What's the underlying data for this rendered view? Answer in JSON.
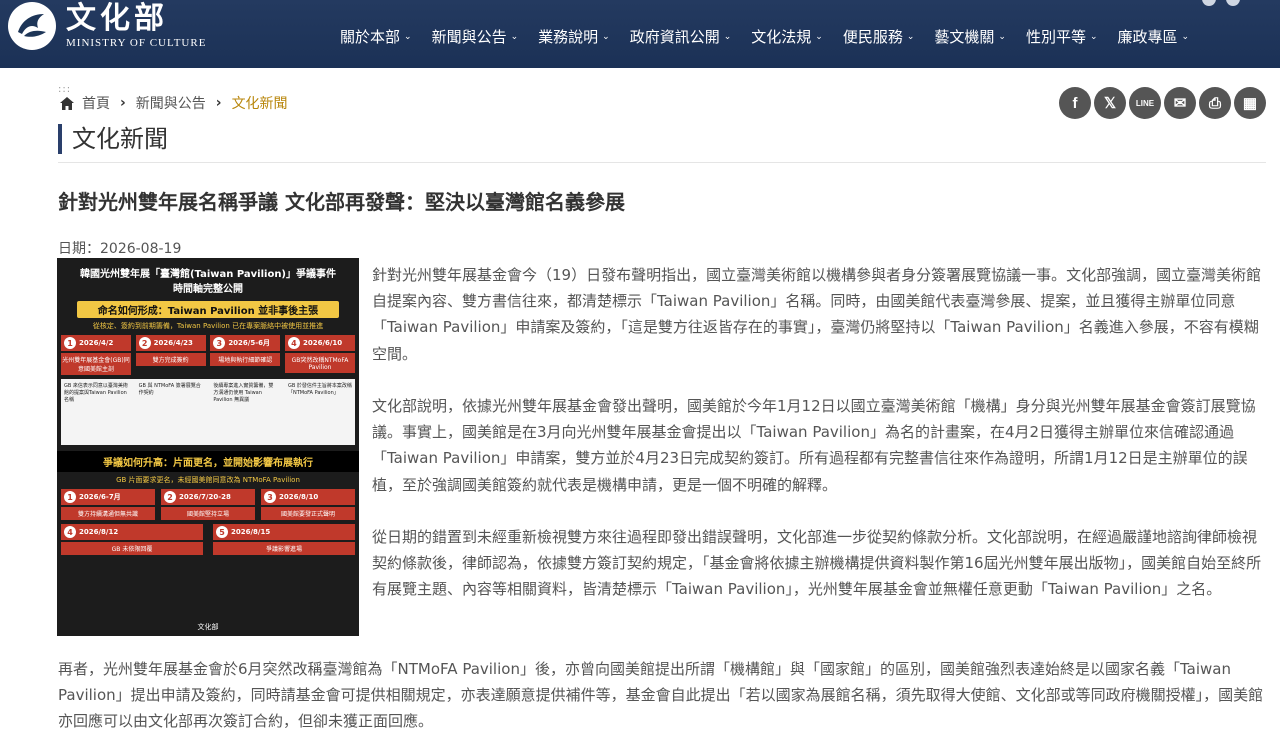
{
  "header": {
    "logo_zh": "文化部",
    "logo_en": "MINISTRY OF CULTURE",
    "nav": [
      {
        "label": "關於本部"
      },
      {
        "label": "新聞與公告"
      },
      {
        "label": "業務說明"
      },
      {
        "label": "政府資訊公開"
      },
      {
        "label": "文化法規"
      },
      {
        "label": "便民服務"
      },
      {
        "label": "藝文機關"
      },
      {
        "label": "性別平等"
      },
      {
        "label": "廉政專區"
      }
    ],
    "colors": {
      "nav_bg": "#1d3557",
      "accent": "#b8860b"
    }
  },
  "breadcrumb": {
    "dots": ":::",
    "home": "首頁",
    "section": "新聞與公告",
    "current": "文化新聞"
  },
  "share": {
    "buttons": [
      {
        "icon": "facebook-icon",
        "glyph": "f"
      },
      {
        "icon": "x-icon",
        "glyph": "𝕏"
      },
      {
        "icon": "line-icon",
        "glyph": "LINE"
      },
      {
        "icon": "email-icon",
        "glyph": "✉"
      },
      {
        "icon": "print-icon",
        "glyph": "⎙"
      },
      {
        "icon": "qrcode-icon",
        "glyph": "▦"
      }
    ]
  },
  "page_title": "文化新聞",
  "article": {
    "headline": "針對光州雙年展名稱爭議 文化部再發聲：堅決以臺灣館名義參展",
    "date": "日期：2026-08-19",
    "paragraphs": [
      "針對光州雙年展基金會今（19）日發布聲明指出，國立臺灣美術館以機構參與者身分簽署展覽協議一事。文化部強調，國立臺灣美術館自提案內容、雙方書信往來，都清楚標示「Taiwan Pavilion」名稱。同時，由國美館代表臺灣參展、提案，並且獲得主辦單位同意「Taiwan Pavilion」申請案及簽約，「這是雙方往返皆存在的事實」，臺灣仍將堅持以「Taiwan Pavilion」名義進入參展，不容有模糊空間。",
      "文化部說明，依據光州雙年展基金會發出聲明，國美館於今年1月12日以國立臺灣美術館「機構」身分與光州雙年展基金會簽訂展覽協議。事實上，國美館是在3月向光州雙年展基金會提出以「Taiwan Pavilion」為名的計畫案，在4月2日獲得主辦單位來信確認通過「Taiwan Pavilion」申請案，雙方並於4月23日完成契約簽訂。所有過程都有完整書信往來作為證明，所謂1月12日是主辦單位的誤植，至於強調國美館簽約就代表是機構申請，更是一個不明確的解釋。",
      "從日期的錯置到未經重新檢視雙方來往過程即發出錯誤聲明，文化部進一步從契約條款分析。文化部說明，在經過嚴謹地諮詢律師檢視契約條款後，律師認為，依據雙方簽訂契約規定，「基金會將依據主辦機構提供資料製作第16屆光州雙年展出版物」，國美館自始至終所有展覽主題、內容等相關資料，皆清楚標示「Taiwan Pavilion」，光州雙年展基金會並無權任意更動「Taiwan Pavilion」之名。",
      "再者，光州雙年展基金會於6月突然改稱臺灣館為「NTMoFA Pavilion」後，亦曾向國美館提出所謂「機構館」與「國家館」的區別，國美館強烈表達始終是以國家名義「Taiwan Pavilion」提出申請及簽約，同時請基金會可提供相關規定，亦表達願意提供補件等，基金會自此提出「若以國家為展館名稱，須先取得大使館、文化部或等同政府機關授權」，國美館亦回應可以由文化部再次簽訂合約，但卻未獲正面回應。"
    ]
  },
  "infographic": {
    "title1": "韓國光州雙年展「臺灣館(Taiwan Pavilion)」爭議事件",
    "title2": "時間軸完整公開",
    "banner1": "命名如何形成：Taiwan Pavilion 並非事後主張",
    "sub1": "從核定、簽約到前期籌備，Taiwan Pavilion 已在專案脈絡中被使用並推進",
    "row1": [
      {
        "num": "1",
        "date": "2026/4/2",
        "cap": "光州雙年展基金會(GB)同意國美館主剖"
      },
      {
        "num": "2",
        "date": "2026/4/23",
        "cap": "雙方完成簽約"
      },
      {
        "num": "3",
        "date": "2026/5-6月",
        "cap": "場地與執行細節確認"
      },
      {
        "num": "4",
        "date": "2026/6/10",
        "cap": "GB突然改稱NTMoFA Pavilion"
      }
    ],
    "panel1": [
      "GB 來信表示同意以臺灣美術館的提案與Taiwan Pavilion名稱",
      "GB 與 NTMoFA 簽署展覽合作契約",
      "後續專案進入實質籌備，雙方溝通仍使用 Taiwan Pavilion 無異議",
      "GB 於發信件主旨將本案改稱「NTMoFA Pavilion」"
    ],
    "banner2": "爭議如何升高：片面更名，並開始影響布展執行",
    "sub2": "GB 片面要求更名，未經國美館同意改為 NTMoFA Pavilion",
    "row2": [
      {
        "num": "1",
        "date": "2026/6-7月",
        "cap": "雙方持續溝通但無共識"
      },
      {
        "num": "2",
        "date": "2026/7/20-28",
        "cap": "國美館堅持立場"
      },
      {
        "num": "3",
        "date": "2026/8/10",
        "cap": "國美館要發正式聲明"
      }
    ],
    "row3": [
      {
        "num": "4",
        "date": "2026/8/12",
        "cap": "GB 未依限回覆"
      },
      {
        "num": "5",
        "date": "2026/8/15",
        "cap": "爭議影響進場"
      }
    ],
    "footer": "文化部"
  }
}
